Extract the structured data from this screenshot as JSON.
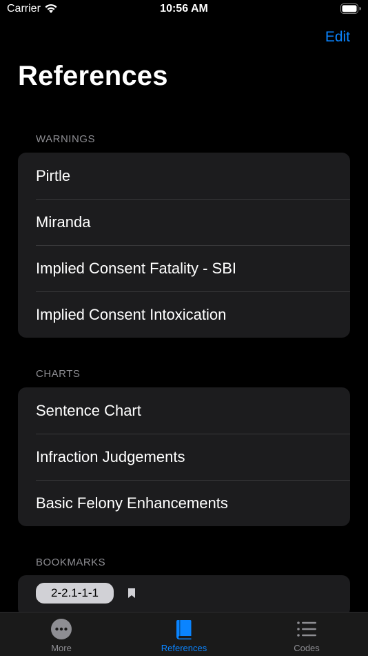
{
  "status_bar": {
    "carrier": "Carrier",
    "time": "10:56 AM"
  },
  "nav": {
    "edit_label": "Edit",
    "title": "References"
  },
  "sections": {
    "warnings": {
      "header": "WARNINGS",
      "items": [
        "Pirtle",
        "Miranda",
        "Implied Consent Fatality - SBI",
        "Implied Consent Intoxication"
      ]
    },
    "charts": {
      "header": "CHARTS",
      "items": [
        "Sentence Chart",
        "Infraction Judgements",
        "Basic Felony Enhancements"
      ]
    },
    "bookmarks": {
      "header": "BOOKMARKS",
      "items": [
        "2-2.1-1-1"
      ]
    }
  },
  "tab_bar": {
    "tabs": [
      {
        "label": "More",
        "icon": "ellipsis-circle-icon",
        "active": false
      },
      {
        "label": "References",
        "icon": "book-icon",
        "active": true
      },
      {
        "label": "Codes",
        "icon": "list-icon",
        "active": false
      }
    ]
  },
  "colors": {
    "accent": "#0a84ff",
    "background": "#000000",
    "cell": "#1c1c1e",
    "secondary_text": "#8e8e93"
  }
}
